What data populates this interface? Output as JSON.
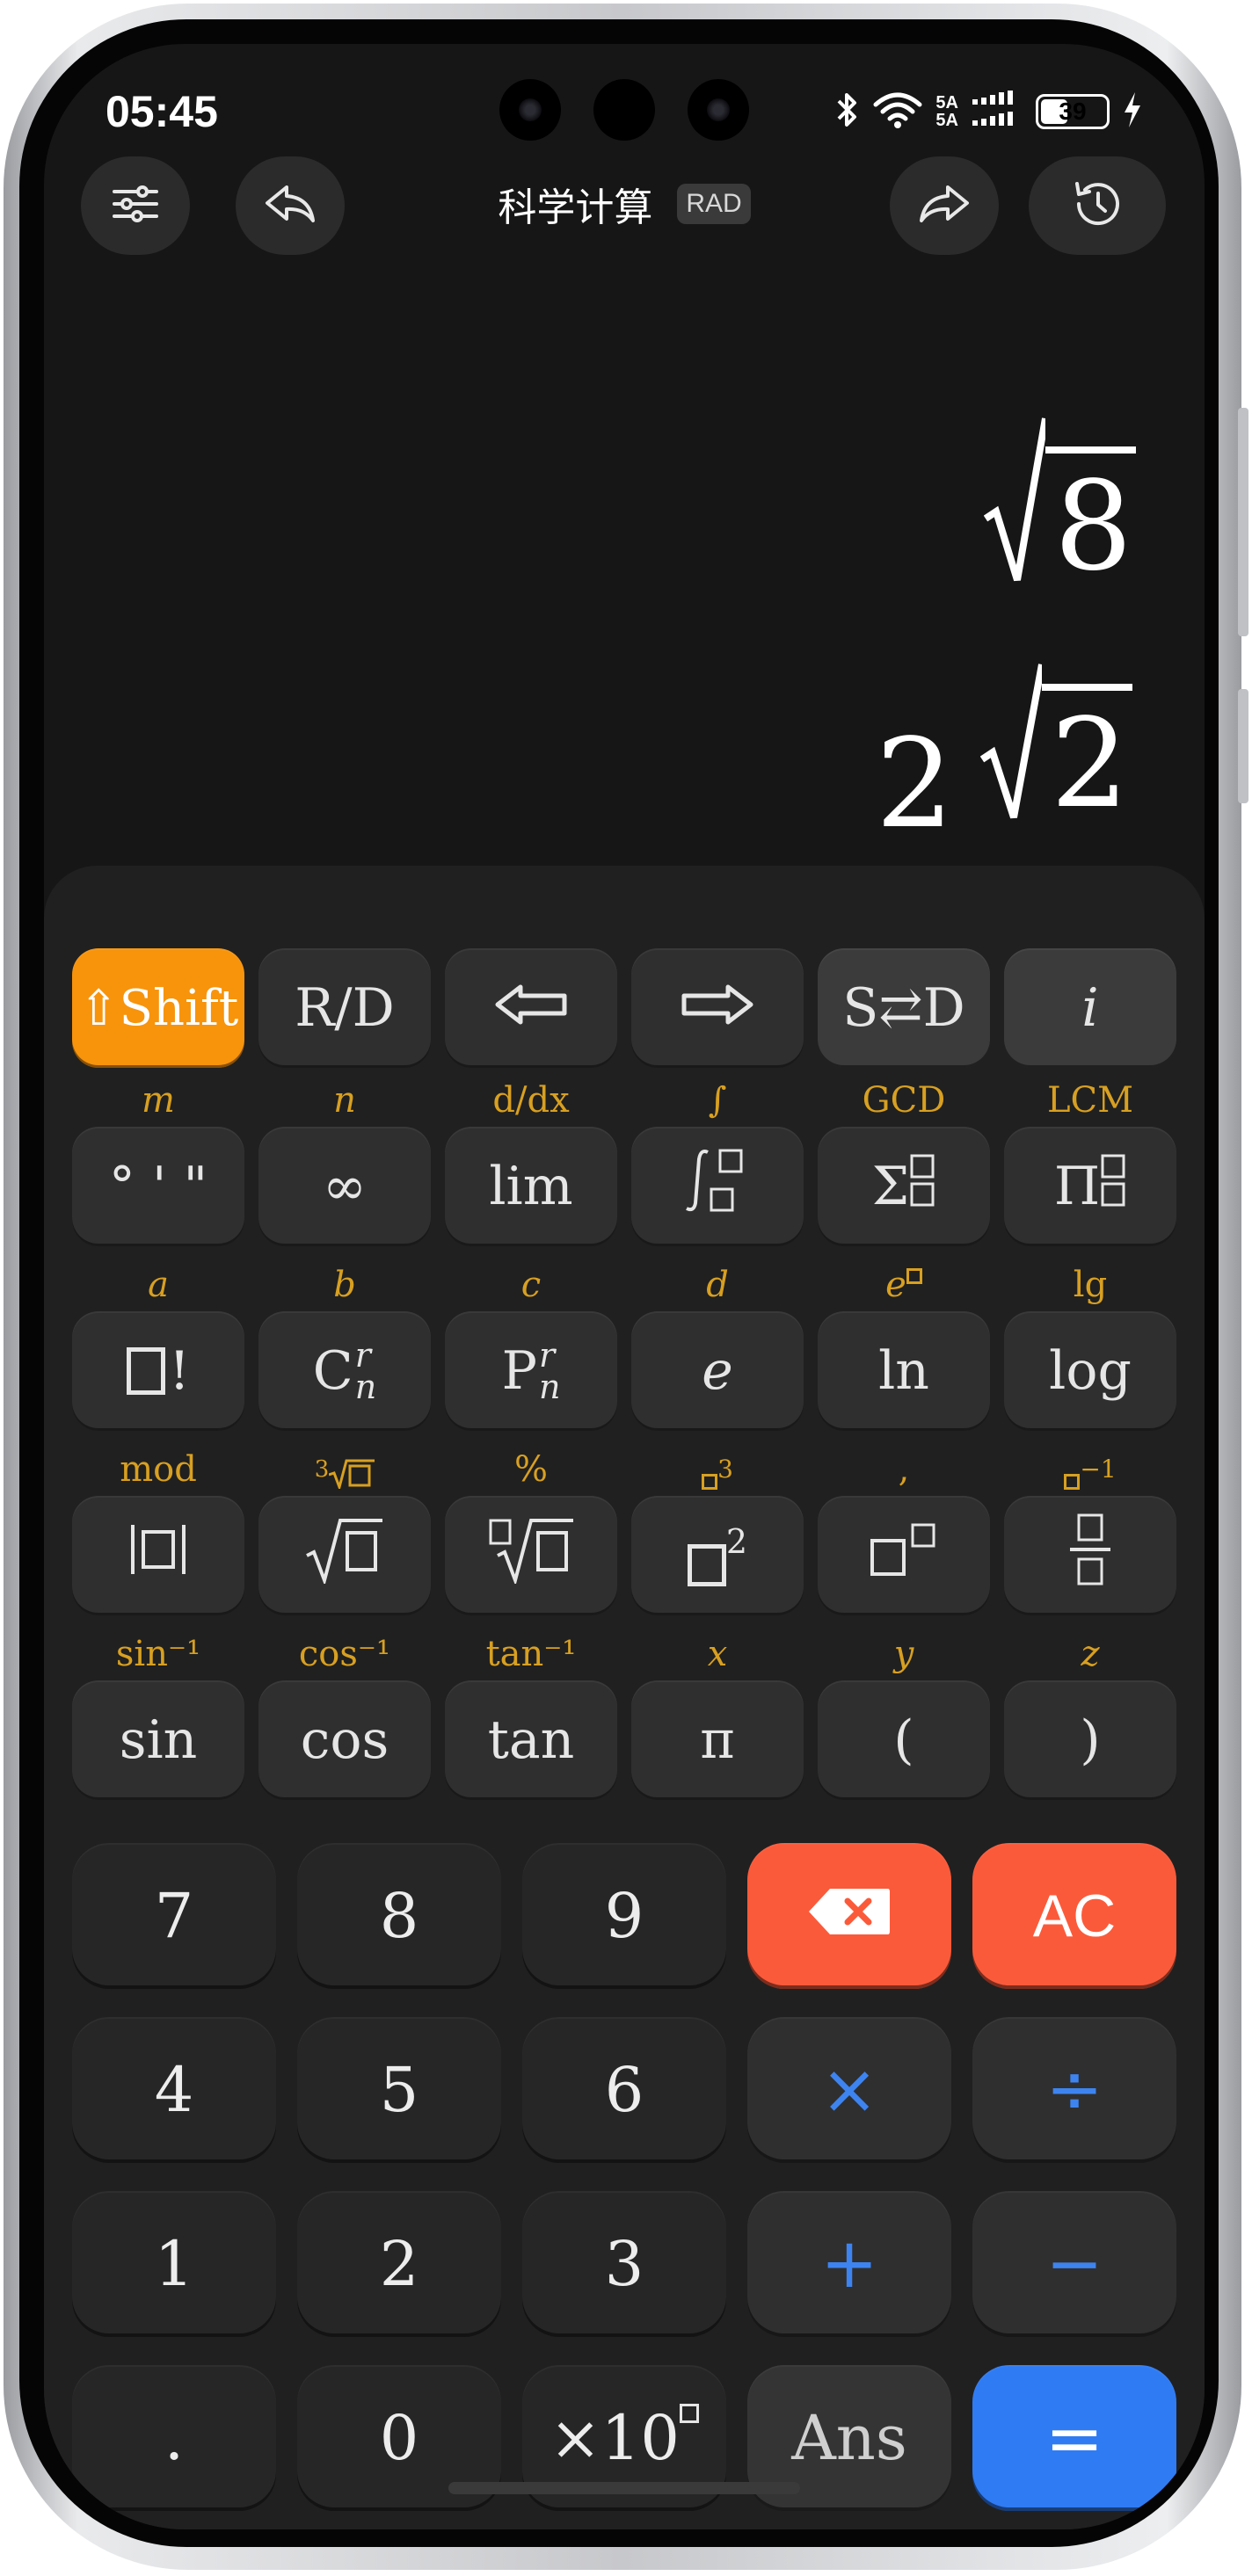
{
  "status": {
    "time": "05:45",
    "network_1": "5A",
    "network_2": "5A",
    "battery": "39"
  },
  "header": {
    "title": "科学计算",
    "mode_badge": "RAD"
  },
  "display": {
    "expression_radicand": "8",
    "result_coefficient": "2",
    "result_radicand": "2"
  },
  "row1": {
    "shift": "⇧Shift",
    "rd": "R/D",
    "sd": "S⇄D",
    "imag": "i"
  },
  "row2": {
    "caps": [
      "m",
      "n",
      "d/dx",
      "∫",
      "GCD",
      "LCM"
    ],
    "dms": "° ' \"",
    "infinity": "∞",
    "lim": "lim",
    "sigma": "Σ",
    "pi_product": "Π"
  },
  "row3": {
    "caps": [
      "a",
      "b",
      "c",
      "d",
      "e",
      "lg"
    ],
    "fact": "!",
    "comb_letter": "C",
    "perm_letter": "P",
    "sup_r": "r",
    "sub_n": "n",
    "e": "e",
    "ln": "ln",
    "log": "log"
  },
  "row4": {
    "caps": [
      "mod",
      "3",
      "%",
      "3",
      ",",
      "−1"
    ]
  },
  "row5": {
    "caps": [
      "sin⁻¹",
      "cos⁻¹",
      "tan⁻¹",
      "x",
      "y",
      "z"
    ],
    "sin": "sin",
    "cos": "cos",
    "tan": "tan",
    "pi": "π",
    "lparen": "(",
    "rparen": ")"
  },
  "numpad": {
    "d7": "7",
    "d8": "8",
    "d9": "9",
    "ac": "AC",
    "d4": "4",
    "d5": "5",
    "d6": "6",
    "mul": "×",
    "div": "÷",
    "d1": "1",
    "d2": "2",
    "d3": "3",
    "add": "+",
    "sub": "−",
    "dot": ".",
    "d0": "0",
    "exp": "×10",
    "ans": "Ans",
    "eq": "="
  },
  "colors": {
    "shift": "#f7940c",
    "caption": "#d8a021",
    "operator": "#3d84f0",
    "clear": "#fb5a3a",
    "equals": "#2f7bf3"
  }
}
